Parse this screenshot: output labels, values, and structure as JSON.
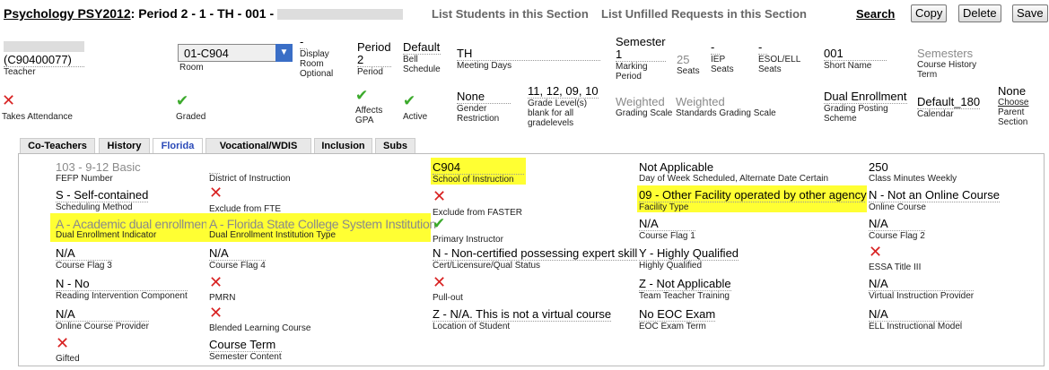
{
  "header": {
    "course_link": "Psychology PSY2012",
    "course_rest": ": Period 2 - 1 - TH - 001 -",
    "list_students": "List Students in this Section",
    "list_unfilled": "List Unfilled Requests in this Section",
    "search": "Search",
    "copy": "Copy",
    "delete": "Delete",
    "save": "Save"
  },
  "info": {
    "teacher_id": "(C90400077)",
    "teacher_label": "Teacher",
    "room_value": "01-C904",
    "room_label": "Room",
    "display_room_dash": "-",
    "display_room_label_1": "Display",
    "display_room_label_2": "Room",
    "display_room_label_3": "Optional",
    "period_value_1": "Period",
    "period_value_2": "2",
    "period_label": "Period",
    "bell_value": "Default",
    "bell_label_1": "Bell",
    "bell_label_2": "Schedule",
    "meeting_value": "TH",
    "meeting_label": "Meeting Days",
    "semester_value_1": "Semester",
    "semester_value_2": "1",
    "semester_label_1": "Marking",
    "semester_label_2": "Period",
    "seats_value": "25",
    "seats_label": "Seats",
    "iep_dash": "-",
    "iep_label_1": "IEP",
    "iep_label_2": "Seats",
    "esol_dash": "-",
    "esol_label_1": "ESOL/ELL",
    "esol_label_2": "Seats",
    "short_value": "001",
    "short_label": "Short Name",
    "semesters_value": "Semesters",
    "semesters_label_1": "Course History",
    "semesters_label_2": "Term",
    "takes_attendance_label": "Takes Attendance",
    "graded_label": "Graded",
    "affects_gpa_label_1": "Affects",
    "affects_gpa_label_2": "GPA",
    "active_label": "Active",
    "gender_value": "None",
    "gender_label_1": "Gender",
    "gender_label_2": "Restriction",
    "grade_value": "11, 12, 09, 10",
    "grade_label_1": "Grade Level(s)",
    "grade_label_2": "blank for all",
    "grade_label_3": "gradelevels",
    "grading_value": "Weighted",
    "grading_label": "Grading Scale",
    "standards_value": "Weighted",
    "standards_label": "Standards Grading Scale",
    "posting_value": "Dual Enrollment",
    "posting_label_1": "Grading Posting",
    "posting_label_2": "Scheme",
    "calendar_value": "Default_180",
    "calendar_label": "Calendar",
    "parent_value": "None",
    "parent_choose": "Choose",
    "parent_label_1": "Parent",
    "parent_label_2": "Section"
  },
  "tabs": [
    "Co-Teachers",
    "History",
    "Florida",
    "Vocational/WDIS",
    "Inclusion",
    "Subs"
  ],
  "florida": {
    "fefp_value": "103 - 9-12 Basic",
    "fefp_label": "FEFP Number",
    "district_label": "District of Instruction",
    "school_value": "C904",
    "school_label": "School of Instruction",
    "dow_value": "Not Applicable",
    "dow_label": "Day of Week Scheduled, Alternate Date Certain",
    "minutes_value": "250",
    "minutes_label": "Class Minutes Weekly",
    "method_value": "S - Self-contained",
    "method_label": "Scheduling Method",
    "fte_label": "Exclude from FTE",
    "faster_label": "Exclude from FASTER",
    "facility_value": "09 - Other Facility operated by other agency",
    "facility_label": "Facility Type",
    "online_value": "N - Not an Online Course",
    "online_label": "Online Course",
    "dual_value": "A - Academic dual enrollment",
    "dual_label": "Dual Enrollment Indicator",
    "inst_value": "A - Florida State College System Institution",
    "inst_label": "Dual Enrollment Institution Type",
    "primary_label": "Primary Instructor",
    "flag1_value": "N/A",
    "flag1_label": "Course Flag 1",
    "flag2_value": "N/A",
    "flag2_label": "Course Flag 2",
    "flag3_value": "N/A",
    "flag3_label": "Course Flag 3",
    "flag4_value": "N/A",
    "flag4_label": "Course Flag 4",
    "cert_value": "N - Non-certified possessing expert skill",
    "cert_label": "Cert/Licensure/Qual Status",
    "hq_value": "Y - Highly Qualified",
    "hq_label": "Highly Qualified",
    "essa_label": "ESSA Title III",
    "reading_value": "N - No",
    "reading_label": "Reading Intervention Component",
    "pmrn_label": "PMRN",
    "pullout_label": "Pull-out",
    "team_value": "Z - Not Applicable",
    "team_label": "Team Teacher Training",
    "virtual_value": "N/A",
    "virtual_label": "Virtual Instruction Provider",
    "online_prov_value": "N/A",
    "online_prov_label": "Online Course Provider",
    "blended_label": "Blended Learning Course",
    "location_value": "Z - N/A. This is not a virtual course",
    "location_label": "Location of Student",
    "eoc_value": "No EOC Exam",
    "eoc_label": "EOC Exam Term",
    "ell_value": "N/A",
    "ell_label": "ELL Instructional Model",
    "gifted_label": "Gifted",
    "term_value": "Course Term",
    "term_label": "Semester Content"
  },
  "icons": {
    "x": "✕",
    "check": "✔"
  },
  "colors": {
    "highlight": "#ffff33",
    "active_tab": "#2a49b8",
    "x_icon": "#d82222",
    "check_icon": "#3caa2c"
  }
}
